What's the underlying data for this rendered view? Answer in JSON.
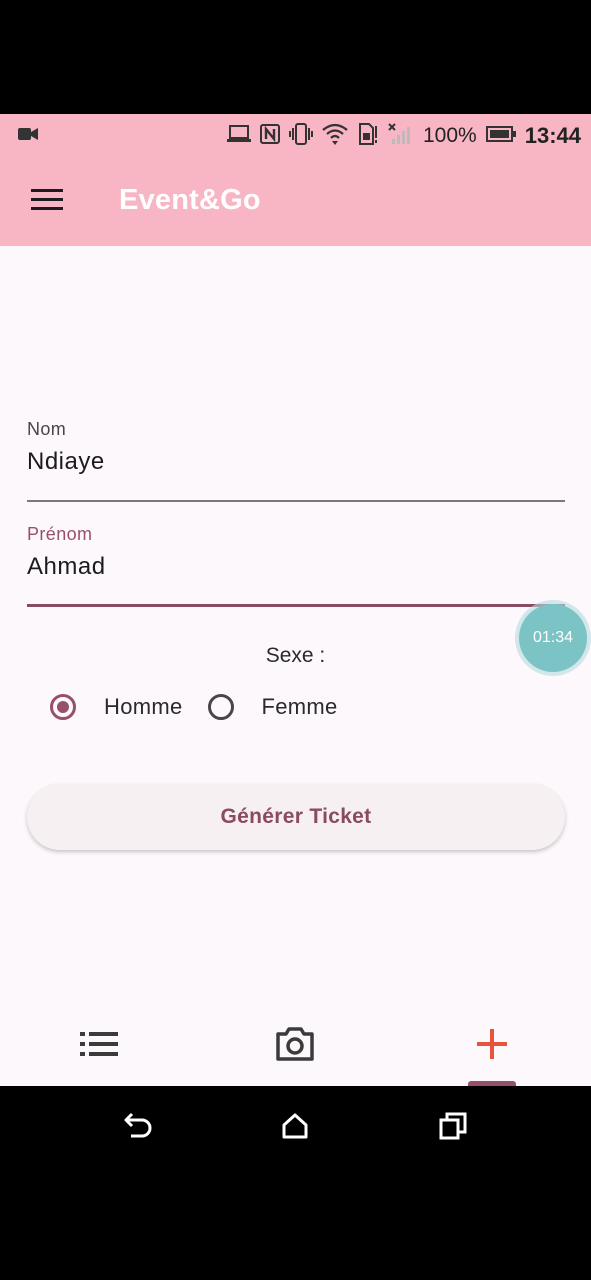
{
  "status_bar": {
    "battery": "100%",
    "time": "13:44",
    "icons": [
      "video-call-icon",
      "laptop-icon",
      "nfc-icon",
      "vibrate-icon",
      "wifi-icon",
      "sim-icon",
      "signal-icon",
      "battery-icon"
    ]
  },
  "app_bar": {
    "title": "Event&Go",
    "menu_icon": "hamburger-menu-icon"
  },
  "form": {
    "nom": {
      "label": "Nom",
      "value": "Ndiaye"
    },
    "prenom": {
      "label": "Prénom",
      "value": "Ahmad"
    },
    "sexe_label": "Sexe :",
    "sexe_options": [
      {
        "label": "Homme",
        "selected": true
      },
      {
        "label": "Femme",
        "selected": false
      }
    ],
    "submit_label": "Générer Ticket"
  },
  "timer_bubble": {
    "text": "01:34"
  },
  "bottom_nav": {
    "items": [
      {
        "icon": "list-icon",
        "active": false
      },
      {
        "icon": "camera-icon",
        "active": false
      },
      {
        "icon": "add-icon",
        "active": true
      }
    ]
  },
  "colors": {
    "app_bar": "#f8b5c3",
    "accent": "#97506a",
    "add_icon": "#e8533a",
    "timer_bubble": "#7cc3c6",
    "background": "#fdf8fc"
  }
}
